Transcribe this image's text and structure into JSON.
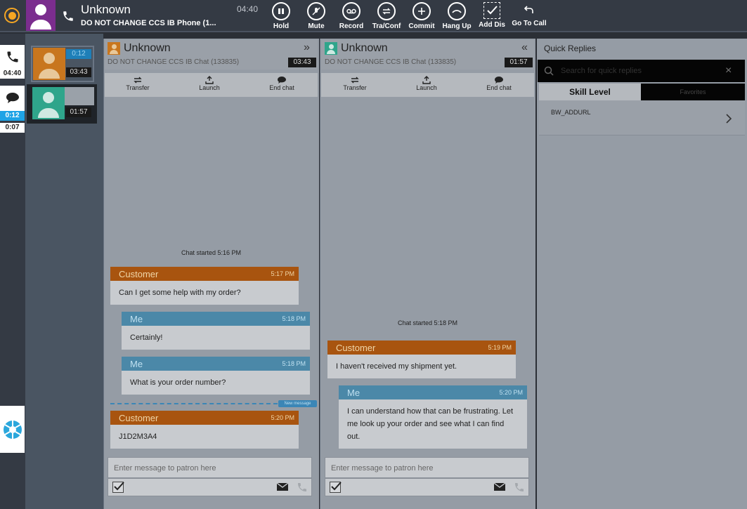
{
  "header": {
    "contact_name": "Unknown",
    "skill_line": "DO NOT CHANGE CCS IB Phone (1...",
    "call_timer": "04:40",
    "controls": [
      {
        "label": "Hold",
        "icon": "pause-icon"
      },
      {
        "label": "Mute",
        "icon": "mic-mute-icon"
      },
      {
        "label": "Record",
        "icon": "voicemail-icon"
      },
      {
        "label": "Tra/Conf",
        "icon": "transfer-arrows-icon"
      },
      {
        "label": "Commit",
        "icon": "plus-circle-icon"
      },
      {
        "label": "Hang Up",
        "icon": "hangup-icon"
      },
      {
        "label": "Add Dis",
        "icon": "checkbox-check-icon"
      },
      {
        "label": "Go To Call",
        "icon": "return-arrow-icon"
      }
    ]
  },
  "left_rail": {
    "phone_time": "04:40",
    "chat_time_primary": "0:12",
    "chat_time_secondary": "0:07"
  },
  "interactions": [
    {
      "top_badge": "0:12",
      "bottom_badge": "03:43",
      "avatar_color": "#c8761e"
    },
    {
      "top_badge": "",
      "bottom_badge": "01:57",
      "avatar_color": "#2fa58b"
    }
  ],
  "chat_panels": [
    {
      "title": "Unknown",
      "subtitle": "DO NOT CHANGE CCS IB Chat (133835)",
      "timer": "03:43",
      "collapse_icon": "»",
      "tools": [
        "Transfer",
        "Launch",
        "End chat"
      ],
      "chat_started": "Chat started 5:16 PM",
      "messages": [
        {
          "sender": "Customer",
          "time": "5:17 PM",
          "text": "Can I get some help with my order?"
        },
        {
          "sender": "Me",
          "time": "5:18 PM",
          "text": "Certainly!"
        },
        {
          "sender": "Me",
          "time": "5:18 PM",
          "text": "What is your order number?"
        },
        {
          "sender": "Customer",
          "time": "5:20 PM",
          "text": "J1D2M3A4"
        }
      ],
      "new_message_marker": "New message",
      "input_placeholder": "Enter message to patron here"
    },
    {
      "title": "Unknown",
      "subtitle": "DO NOT CHANGE CCS IB Chat (133835)",
      "timer": "01:57",
      "collapse_icon": "«",
      "tools": [
        "Transfer",
        "Launch",
        "End chat"
      ],
      "chat_started": "Chat started 5:18 PM",
      "messages": [
        {
          "sender": "Customer",
          "time": "5:19 PM",
          "text": "I haven't received my shipment yet."
        },
        {
          "sender": "Me",
          "time": "5:20 PM",
          "text": "I can understand how that can be frustrating. Let me look up your order and see what I can find out."
        }
      ],
      "input_placeholder": "Enter message to patron here"
    }
  ],
  "quick_replies": {
    "title": "Quick Replies",
    "search_placeholder": "Search for quick replies",
    "tabs": [
      "Skill Level",
      "Favorites"
    ],
    "items": [
      "BW_ADDURL"
    ]
  }
}
